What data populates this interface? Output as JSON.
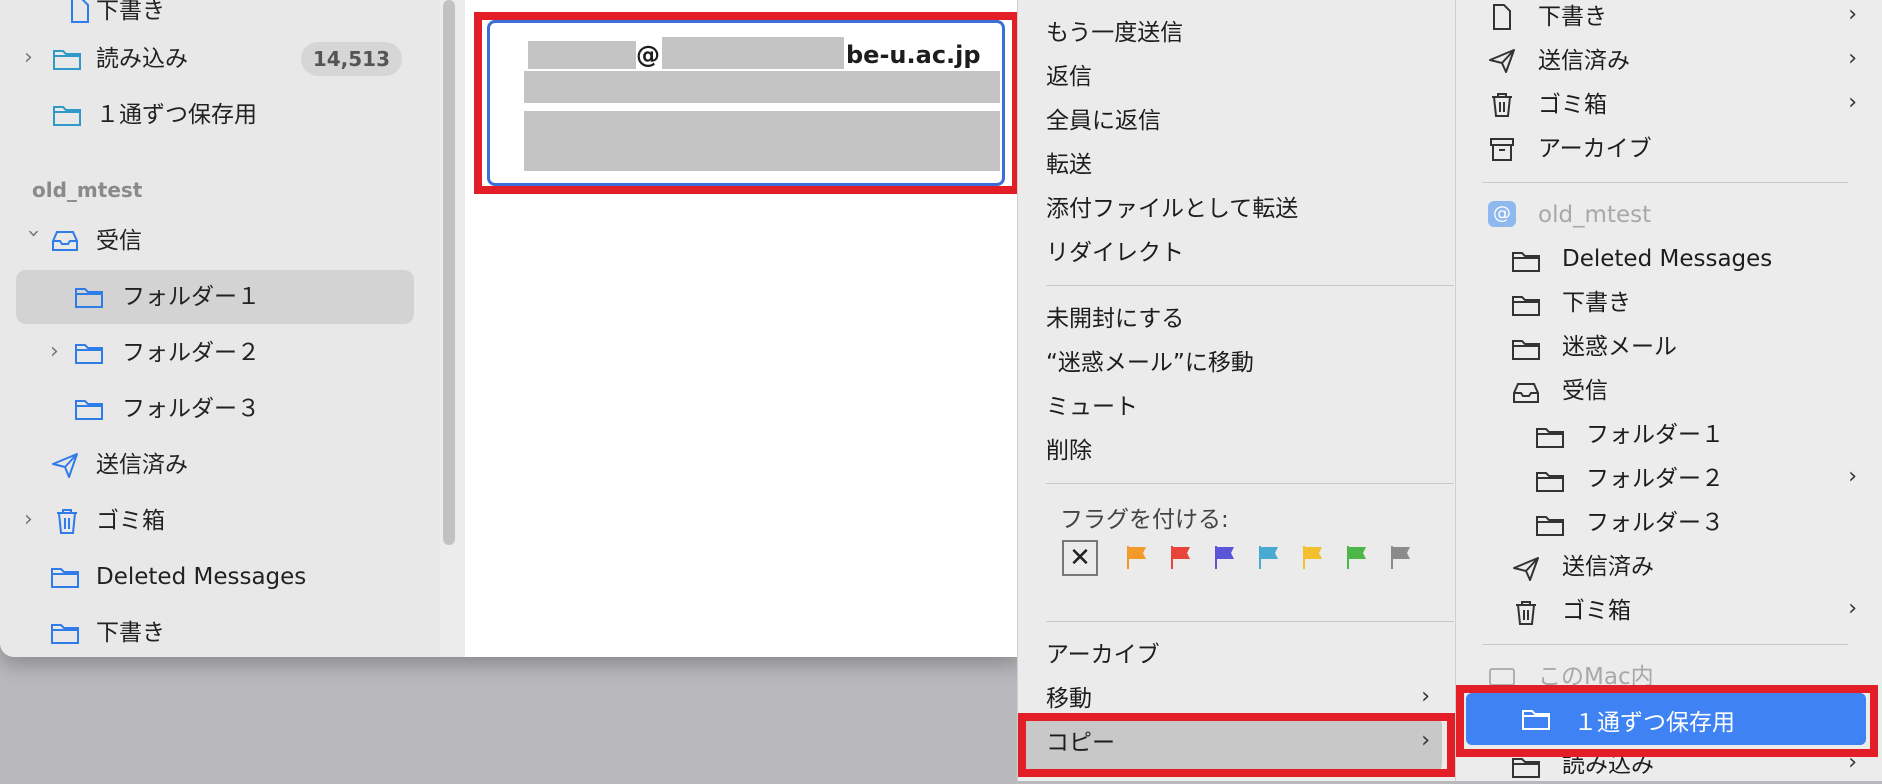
{
  "sidebar": {
    "rows": [
      {
        "label": "下書き",
        "icon": "doc-icon"
      },
      {
        "label": "読み込み",
        "icon": "folder-icon",
        "badge": "14,513",
        "chevron": true
      },
      {
        "label": "１通ずつ保存用",
        "icon": "folder-icon"
      },
      {
        "label": "受信",
        "icon": "inbox-icon",
        "expanded": true
      },
      {
        "label": "フォルダー１",
        "icon": "folder-icon",
        "selected": true
      },
      {
        "label": "フォルダー２",
        "icon": "folder-icon",
        "chevron": true
      },
      {
        "label": "フォルダー３",
        "icon": "folder-icon"
      },
      {
        "label": "送信済み",
        "icon": "paperplane-icon"
      },
      {
        "label": "ゴミ箱",
        "icon": "trash-icon",
        "chevron": true
      },
      {
        "label": "Deleted Messages",
        "icon": "folder-icon"
      },
      {
        "label": "下書き",
        "icon": "folder-icon"
      }
    ],
    "section_label": "old_mtest"
  },
  "message": {
    "from_visible": "@",
    "from_domain": "be-u.ac.jp"
  },
  "context_menu": {
    "items": [
      {
        "label": "もう一度送信"
      },
      {
        "label": "返信"
      },
      {
        "label": "全員に返信"
      },
      {
        "label": "転送"
      },
      {
        "label": "添付ファイルとして転送"
      },
      {
        "label": "リダイレクト"
      },
      {
        "label": "未開封にする"
      },
      {
        "label": "“迷惑メール”に移動"
      },
      {
        "label": "ミュート"
      },
      {
        "label": "削除"
      },
      {
        "label": "アーカイブ"
      },
      {
        "label": "移動",
        "submenu": true
      },
      {
        "label": "コピー",
        "submenu": true,
        "highlighted": true
      }
    ],
    "flag_label": "フラグを付ける:",
    "flag_none_symbol": "✕",
    "flag_colors": [
      "#f39a2b",
      "#e8443a",
      "#5b55d8",
      "#4aabd1",
      "#f2c02f",
      "#4cb748",
      "#8b8b8b"
    ]
  },
  "submenu": {
    "items": [
      {
        "label": "下書き",
        "icon": "doc-icon",
        "chevron": true
      },
      {
        "label": "送信済み",
        "icon": "paperplane-icon",
        "chevron": true
      },
      {
        "label": "ゴミ箱",
        "icon": "trash-icon",
        "chevron": true
      },
      {
        "label": "アーカイブ",
        "icon": "archive-icon"
      },
      {
        "label": "old_mtest",
        "icon": "at-icon",
        "disabled": true
      },
      {
        "label": "Deleted Messages",
        "icon": "folder-icon"
      },
      {
        "label": "下書き",
        "icon": "folder-icon"
      },
      {
        "label": "迷惑メール",
        "icon": "folder-icon"
      },
      {
        "label": "受信",
        "icon": "inbox-icon"
      },
      {
        "label": "フォルダー１",
        "icon": "folder-icon"
      },
      {
        "label": "フォルダー２",
        "icon": "folder-icon",
        "chevron": true
      },
      {
        "label": "フォルダー３",
        "icon": "folder-icon"
      },
      {
        "label": "送信済み",
        "icon": "paperplane-icon"
      },
      {
        "label": "ゴミ箱",
        "icon": "trash-icon",
        "chevron": true
      },
      {
        "label": "このMac内",
        "icon": "computer-icon",
        "disabled": true
      },
      {
        "label": "１通ずつ保存用",
        "icon": "folder-icon",
        "highlighted": true
      },
      {
        "label": "読み込み",
        "icon": "folder-icon",
        "chevron": true
      }
    ],
    "chevron_symbol": "›"
  },
  "colors": {
    "accent": "#3f82f3",
    "highlight_frame": "#e41e26",
    "folder_blue": "#2f7be8"
  }
}
